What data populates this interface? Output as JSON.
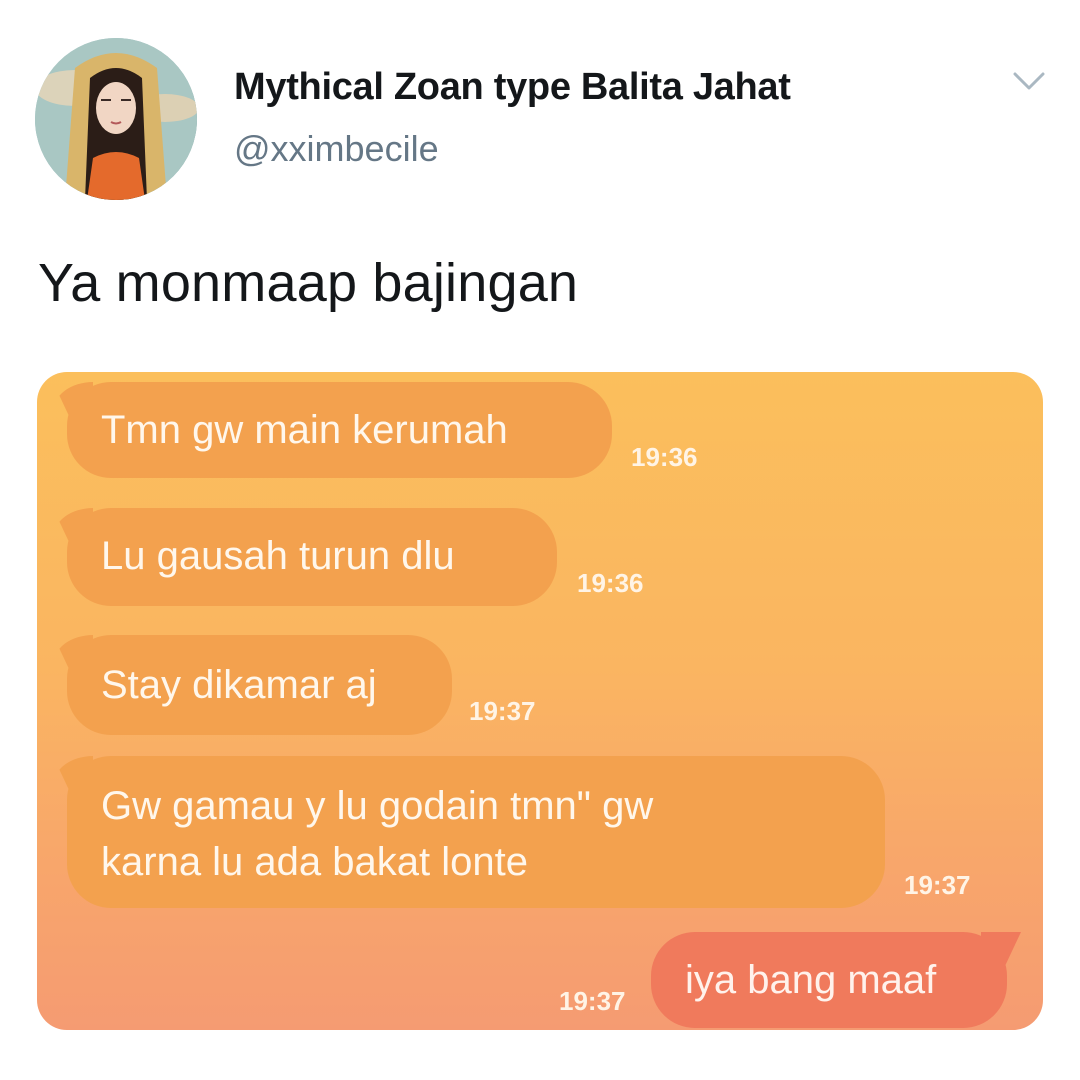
{
  "tweet": {
    "display_name": "Mythical Zoan type Balita Jahat",
    "handle": "@xximbecile",
    "text": "Ya monmaap bajingan"
  },
  "chat": {
    "messages": [
      {
        "side": "received",
        "lines": [
          "Tmn gw main kerumah"
        ],
        "time": "19:36"
      },
      {
        "side": "received",
        "lines": [
          "Lu gausah turun dlu"
        ],
        "time": "19:36"
      },
      {
        "side": "received",
        "lines": [
          "Stay dikamar aj"
        ],
        "time": "19:37"
      },
      {
        "side": "received",
        "lines": [
          "Gw gamau y lu godain tmn\" gw",
          "karna lu ada bakat lonte"
        ],
        "time": "19:37"
      },
      {
        "side": "sent",
        "lines": [
          "iya bang maaf"
        ],
        "time": "19:37"
      }
    ]
  },
  "colors": {
    "received_bubble": "#f3a14e",
    "sent_bubble": "#f07a5c",
    "chat_bg_top": "#fbbf5c",
    "chat_bg_bottom": "#f59b72",
    "handle_gray": "#657786"
  },
  "icons": {
    "menu": "chevron-down-icon"
  }
}
